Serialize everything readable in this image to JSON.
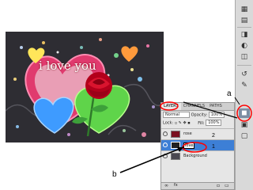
{
  "canvas": {
    "caption": "i love you"
  },
  "layers_panel": {
    "tabs": [
      "LAYERS",
      "CHANNELS",
      "PATHS"
    ],
    "blend_mode": "Normal",
    "opacity_label": "Opacity:",
    "opacity_value": "100%",
    "lock_label": "Lock:",
    "fill_label": "Fill:",
    "fill_value": "100%",
    "layers": [
      {
        "name": "rose",
        "number": "2"
      },
      {
        "name": "love",
        "number": "1"
      },
      {
        "name": "Background"
      }
    ]
  },
  "annotations": {
    "a": "a",
    "b": "b"
  },
  "colors": {
    "highlight_circle": "#ff0000",
    "selected_layer": "#3d7fd6",
    "canvas_bg": "#2e2d33"
  },
  "icons": [
    "eye-icon",
    "lock-icon",
    "link-icon",
    "layers-icon"
  ]
}
